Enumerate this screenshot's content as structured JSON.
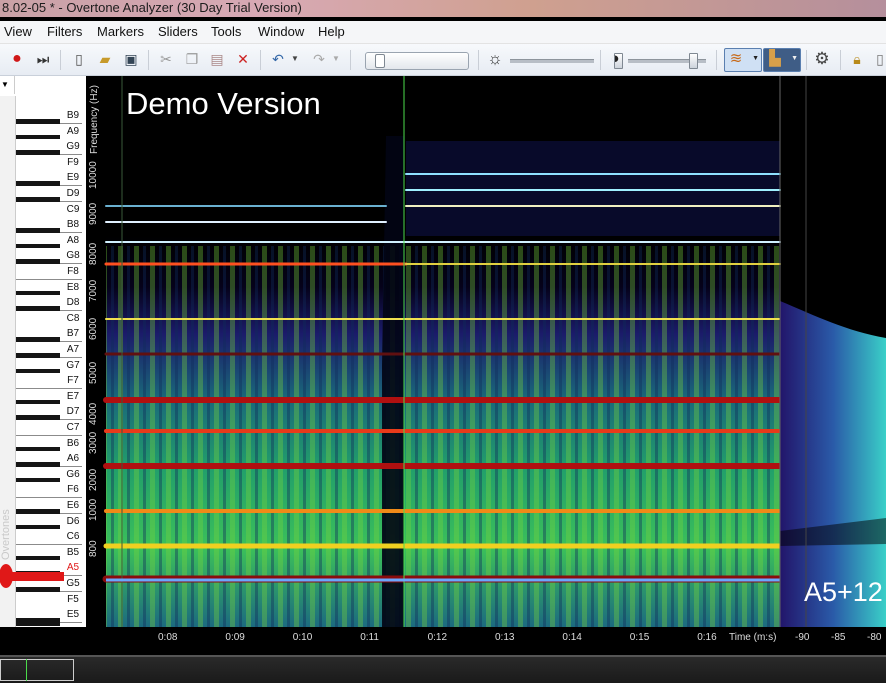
{
  "window": {
    "title": "8.02-05 * - Overtone Analyzer (30 Day Trial Version)"
  },
  "menu": [
    "View",
    "Filters",
    "Markers",
    "Sliders",
    "Tools",
    "Window",
    "Help"
  ],
  "toolbar": {
    "icons": [
      "record-icon",
      "skip-end-icon",
      "new-file-icon",
      "open-folder-icon",
      "save-icon",
      "cut-icon",
      "copy-icon",
      "paste-icon",
      "delete-icon",
      "undo-icon",
      "redo-icon",
      "brightness-icon",
      "contrast-icon",
      "spectrogram-color-icon",
      "spectrum-view-icon",
      "gear-icon",
      "lock-icon"
    ],
    "brightness": 0.76,
    "contrast": 0.27
  },
  "keyboard": {
    "notes": [
      "B9",
      "A9",
      "G9",
      "F9",
      "E9",
      "D9",
      "C9",
      "B8",
      "A8",
      "G8",
      "F8",
      "E8",
      "D8",
      "C8",
      "B7",
      "A7",
      "G7",
      "F7",
      "E7",
      "D7",
      "C7",
      "B6",
      "A6",
      "G6",
      "F6",
      "E6",
      "D6",
      "C6",
      "B5",
      "A5",
      "G5",
      "F5",
      "E5"
    ],
    "highlighted": "A5",
    "vertical_label": "Overtones"
  },
  "spectrogram": {
    "watermark": "Demo Version",
    "current_note": "A5+12",
    "frequency_axis_label": "Frequency (Hz)",
    "frequency_ticks": [
      "10000",
      "9000",
      "8000",
      "7000",
      "6000",
      "5000",
      "4000",
      "3000",
      "2000",
      "1000",
      "800"
    ],
    "time_axis_label": "Time (m:s)",
    "time_ticks": [
      "0:08",
      "0:09",
      "0:10",
      "0:11",
      "0:12",
      "0:13",
      "0:14",
      "0:15",
      "0:16"
    ],
    "db_ticks": [
      "-90",
      "-85",
      "-80"
    ]
  },
  "colors": {
    "accent": "#2f6fd0",
    "marker": "#e01818",
    "cursor": "#4bdc4b"
  }
}
